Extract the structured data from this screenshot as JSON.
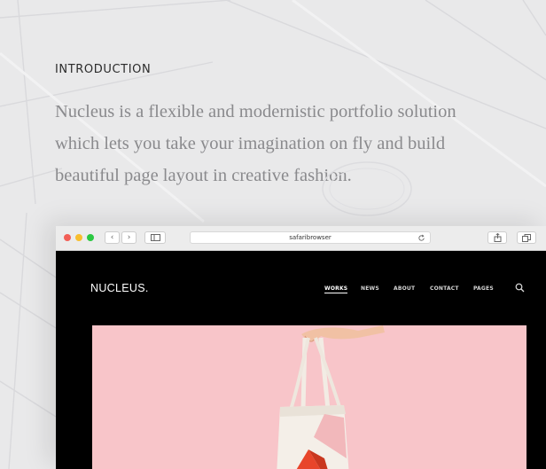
{
  "intro": {
    "title": "INTRODUCTION",
    "lines": [
      "Nucleus is a flexible and modernistic portfolio solution",
      "which lets you take your imagination on fly and build",
      "beautiful page layout in creative fashion."
    ]
  },
  "browser": {
    "address": "safaribrowser",
    "back_glyph": "‹",
    "forward_glyph": "›"
  },
  "site": {
    "logo": "NUCLEUS.",
    "nav": [
      "WORKS",
      "NEWS",
      "ABOUT",
      "CONTACT",
      "PAGES"
    ],
    "active_nav": "WORKS"
  },
  "colors": {
    "background": "#e9e9ea",
    "hero_pink": "#f8c5c9",
    "bag_orange": "#e8452a",
    "text_gray": "#8a8a8d"
  },
  "icons": [
    "search-icon",
    "share-icon",
    "tabs-icon",
    "sidebar-icon",
    "reload-icon"
  ]
}
